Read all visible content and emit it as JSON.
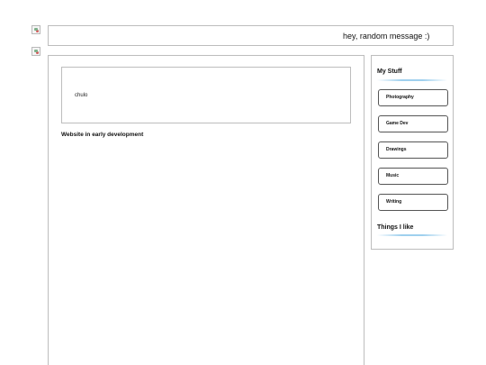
{
  "header": {
    "message": "hey, random message :)"
  },
  "main": {
    "inner_box_text": "chulo",
    "status_note": "Website in early development"
  },
  "sidebar": {
    "section_my_stuff": "My Stuff",
    "items": [
      {
        "label": "Photography"
      },
      {
        "label": "Game Dev"
      },
      {
        "label": "Drawings"
      },
      {
        "label": "Music"
      },
      {
        "label": "Writing"
      }
    ],
    "section_things_i_like": "Things I like"
  }
}
